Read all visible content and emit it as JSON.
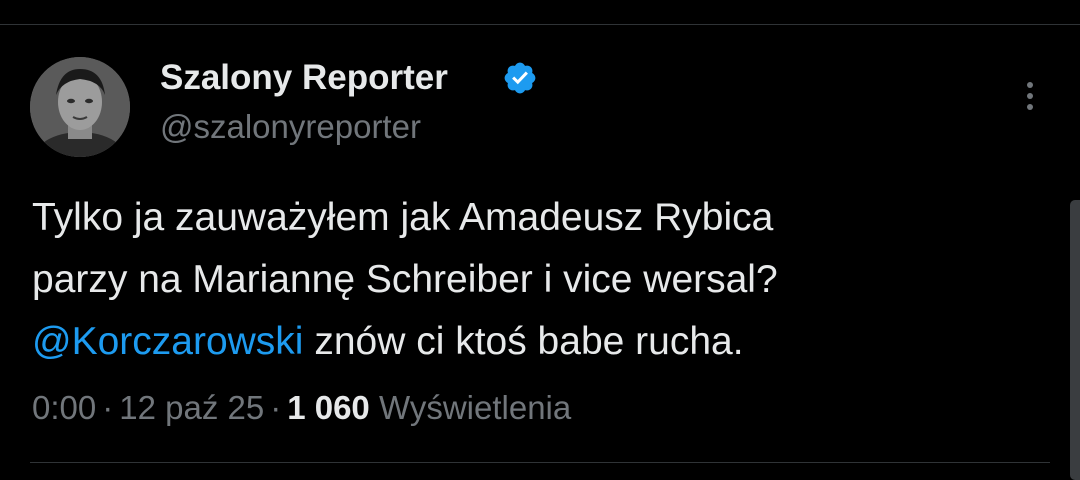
{
  "tweet": {
    "author": {
      "display_name": "Szalony Reporter",
      "handle": "@szalonyreporter",
      "verified_icon": "verified-badge-icon",
      "avatar_icon": "avatar-photo"
    },
    "menu_icon": "more-options-icon",
    "text": {
      "line1": "Tylko ja zauważyłem jak Amadeusz Rybica",
      "line2": "parzy na Mariannę Schreiber i vice wersal?",
      "mention": "@Korczarowski",
      "line3_rest": " znów ci ktoś babe rucha."
    },
    "meta": {
      "time": "0:00",
      "separator": "·",
      "date": "12 paź 25",
      "views_count": "1 060",
      "views_label": "Wyświetlenia"
    }
  },
  "colors": {
    "background": "#000000",
    "text": "#e7e9ea",
    "secondary_text": "#71767b",
    "accent": "#1d9bf0",
    "divider": "#2f3336"
  }
}
